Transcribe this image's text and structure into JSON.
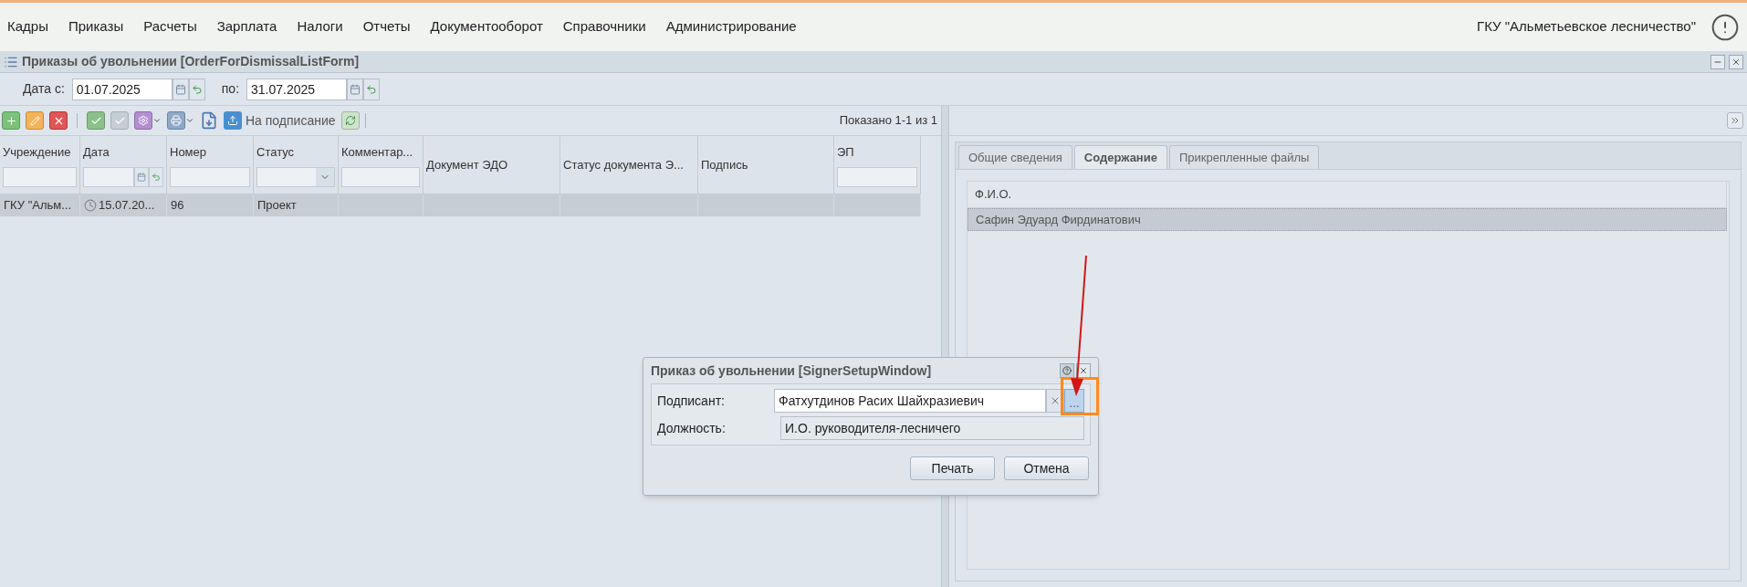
{
  "menu": {
    "items": [
      "Кадры",
      "Приказы",
      "Расчеты",
      "Зарплата",
      "Налоги",
      "Отчеты",
      "Документооборот",
      "Справочники",
      "Администрирование"
    ],
    "organization": "ГКУ \"Альметьевское лесничество\""
  },
  "list_window": {
    "title": "Приказы об увольнении [OrderForDismissalListForm]",
    "date_from": {
      "label": "Дата с:",
      "value": "01.07.2025"
    },
    "date_to": {
      "label": "по:",
      "value": "31.07.2025"
    },
    "toolbar": {
      "sign_button": "На подписание",
      "paging": "Показано 1-1 из 1"
    },
    "table": {
      "columns": [
        {
          "label": "Учреждение",
          "kind": "text"
        },
        {
          "label": "Дата",
          "kind": "date"
        },
        {
          "label": "Номер",
          "kind": "text"
        },
        {
          "label": "Статус",
          "kind": "select"
        },
        {
          "label": "Комментар...",
          "kind": "text"
        },
        {
          "label": "Документ ЭДО",
          "kind": "plain"
        },
        {
          "label": "Статус документа Э...",
          "kind": "plain"
        },
        {
          "label": "Подпись",
          "kind": "plain"
        },
        {
          "label": "ЭП",
          "kind": "text"
        }
      ],
      "rows": [
        {
          "selected": true,
          "cells": [
            "ГКУ \"Альм...",
            "15.07.20...",
            "96",
            "Проект"
          ]
        }
      ]
    }
  },
  "detail_panel": {
    "tabs": [
      {
        "label": "Общие сведения",
        "selected": false
      },
      {
        "label": "Содержание",
        "selected": true
      },
      {
        "label": "Прикрепленные файлы",
        "selected": false
      }
    ],
    "grid": {
      "column": "Ф.И.О.",
      "rows": [
        {
          "selected": true,
          "name": "Сафин Эдуард Фирдинатович"
        }
      ]
    }
  },
  "dialog": {
    "title": "Приказ об увольнении [SignerSetupWindow]",
    "fields": [
      {
        "label": "Подписант:",
        "value": "Фатхутдинов Расих Шайхразиевич",
        "kind": "lookup",
        "button": "…"
      },
      {
        "label": "Должность:",
        "value": "И.О. руководителя-лесничего",
        "kind": "readonly"
      }
    ],
    "buttons": [
      "Печать",
      "Отмена"
    ]
  }
}
